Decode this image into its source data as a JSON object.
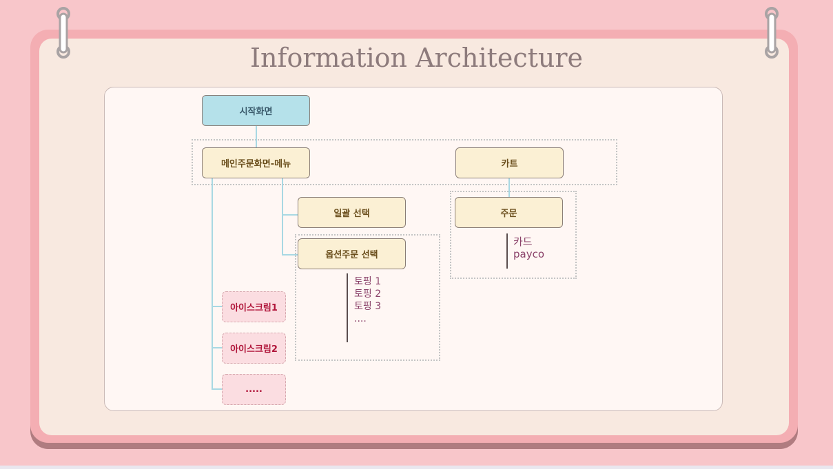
{
  "title": "Information Architecture",
  "nodes": {
    "start": "시작화면",
    "main_menu": "메인주문화면-메뉴",
    "cart": "카트",
    "bulk_select": "일괄 선택",
    "option_order": "옵션주문 선택",
    "order": "주문",
    "icecream1": "아이스크림1",
    "icecream2": "아이스크림2",
    "icecream_more": "....."
  },
  "toppings": [
    "토핑 1",
    "토핑 2",
    "토핑 3",
    "...."
  ],
  "payment": [
    "카드",
    "payco"
  ],
  "colors": {
    "background": "#f8c6ca",
    "frame": "#f4aeb3",
    "start_node": "#b5e1ea",
    "menu_node": "#fbf0d4",
    "item_node": "#fbdde1",
    "connector": "#a8d8e3"
  }
}
